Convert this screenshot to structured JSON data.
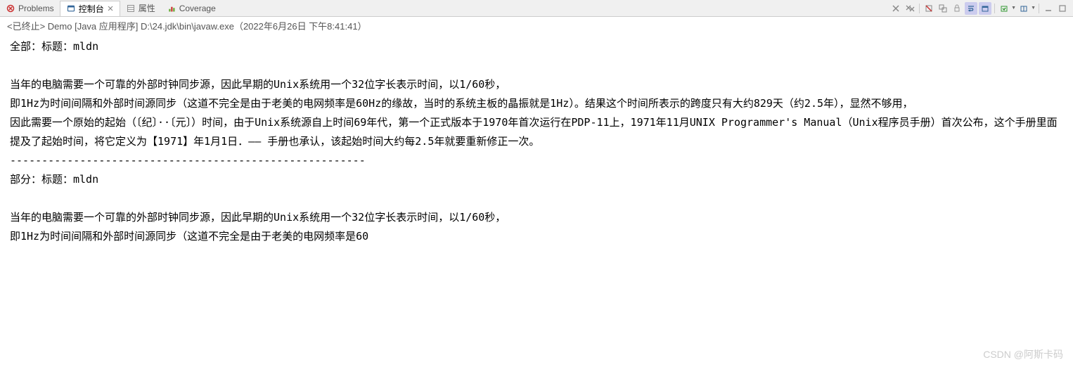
{
  "tabs": {
    "problems": {
      "label": "Problems"
    },
    "console": {
      "label": "控制台"
    },
    "properties": {
      "label": "属性"
    },
    "coverage": {
      "label": "Coverage"
    }
  },
  "statusLine": "<已终止> Demo [Java 应用程序] D:\\24.jdk\\bin\\javaw.exe（2022年6月26日 下午8:41:41）",
  "consoleOutput": "全部：标题：mldn\n\n当年的电脑需要一个可靠的外部时钟同步源，因此早期的Unix系统用一个32位字长表示时间，以1/60秒，\n即1Hz为时间间隔和外部时间源同步（这道不完全是由于老美的电网频率是60Hz的缘故，当时的系统主板的晶振就是1Hz）。结果这个时间所表示的跨度只有大约829天（约2.5年），显然不够用，\n因此需要一个原始的起始（〔纪〕··〔元〕）时间，由于Unix系统源自上时间69年代，第一个正式版本于1970年首次运行在PDP-11上，1971年11月UNIX Programmer's Manual（Unix程序员手册）首次公布，这个手册里面提及了起始时间，将它定义为【1971】年1月1日．—— 手册也承认，该起始时间大约每2.5年就要重新修正一次。\n--------------------------------------------------------\n部分：标题：mldn\n\n当年的电脑需要一个可靠的外部时钟同步源，因此早期的Unix系统用一个32位字长表示时间，以1/60秒，\n即1Hz为时间间隔和外部时间源同步（这道不完全是由于老美的电网频率是60",
  "watermark": "CSDN @阿斯卡码"
}
